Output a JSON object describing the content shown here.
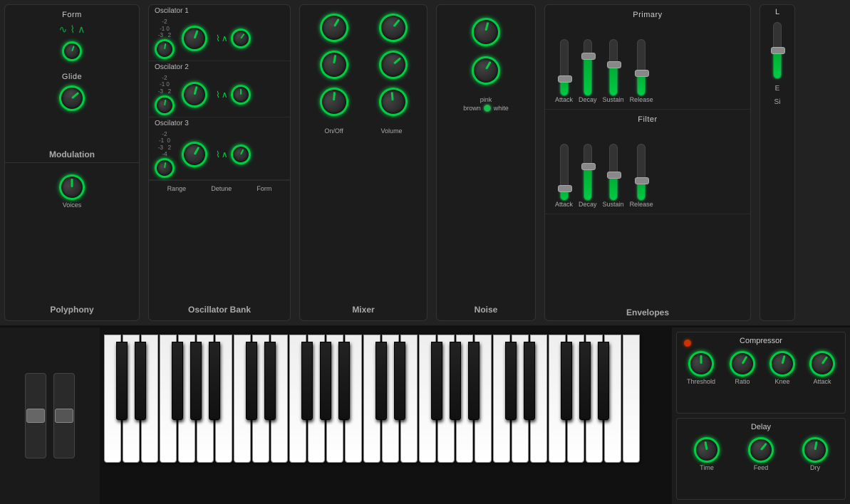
{
  "panels": {
    "polyphony": {
      "form_label": "Form",
      "glide_label": "Glide",
      "modulation_label": "Modulation",
      "voices_label": "Voices",
      "polyphony_label": "Polyphony"
    },
    "oscillator": {
      "title": "Oscillator Bank",
      "osc1_title": "Oscilator 1",
      "osc2_title": "Oscilator 2",
      "osc3_title": "Oscilator 3",
      "range_label": "Range",
      "detune_label": "Detune",
      "form_label": "Form",
      "range1": "-2\n-1  0\n-3      2",
      "range2": "-2\n-1  0\n-3      2",
      "range3": "-2\n-1  0\n-3      2\n-4"
    },
    "mixer": {
      "title": "Mixer",
      "onoff_label": "On/Off",
      "volume_label": "Volume"
    },
    "noise": {
      "title": "Noise",
      "pink_label": "pink",
      "brown_label": "brown",
      "white_label": "white"
    },
    "envelopes": {
      "title": "Envelopes",
      "primary_label": "Primary",
      "filter_label": "Filter",
      "attack_label": "Attack",
      "decay_label": "Decay",
      "sustain_label": "Sustain",
      "release_label": "Release"
    }
  },
  "compressor": {
    "title": "Compressor",
    "threshold_label": "Threshold",
    "ratio_label": "Ratio",
    "knee_label": "Knee",
    "attack_label": "Attack"
  },
  "delay": {
    "title": "Delay",
    "time_label": "Time",
    "feed_label": "Feed",
    "dry_label": "Dry"
  },
  "piano": {
    "octaves": 4
  }
}
